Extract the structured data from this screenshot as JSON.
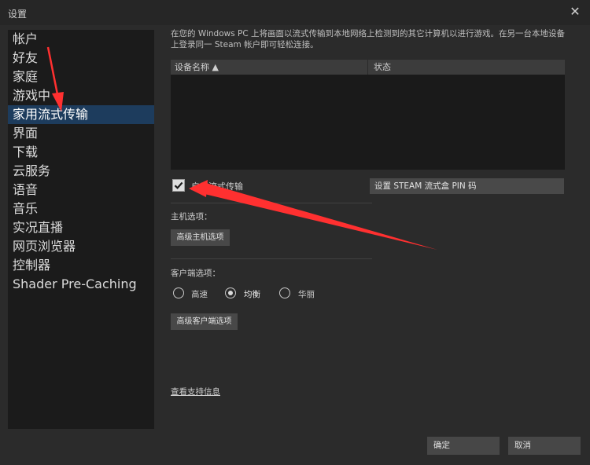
{
  "window": {
    "title": "设置",
    "close_glyph": "✕"
  },
  "sidebar": {
    "items": [
      {
        "label": "帐户"
      },
      {
        "label": "好友"
      },
      {
        "label": "家庭"
      },
      {
        "label": "游戏中"
      },
      {
        "label": "家用流式传输",
        "active": true
      },
      {
        "label": "界面"
      },
      {
        "label": "下载"
      },
      {
        "label": "云服务"
      },
      {
        "label": "语音"
      },
      {
        "label": "音乐"
      },
      {
        "label": "实况直播"
      },
      {
        "label": "网页浏览器"
      },
      {
        "label": "控制器"
      },
      {
        "label": "Shader Pre-Caching"
      }
    ]
  },
  "main": {
    "description": "在您的 Windows PC 上将画面以流式传输到本地网络上检测到的其它计算机以进行游戏。在另一台本地设备上登录同一 Steam 帐户即可轻松连接。",
    "table": {
      "col_device": "设备名称 ▲",
      "col_status": "状态"
    },
    "enable_streaming": {
      "label": "启用流式传输",
      "checked": true
    },
    "pin_button": "设置 STEAM 流式盒 PIN 码",
    "host_options": {
      "label": "主机选项：",
      "button": "高级主机选项"
    },
    "client_options": {
      "label": "客户端选项：",
      "radios": [
        {
          "label": "高速",
          "selected": false
        },
        {
          "label": "均衡",
          "selected": true
        },
        {
          "label": "华丽",
          "selected": false
        }
      ],
      "button": "高级客户端选项"
    },
    "support_link": "查看支持信息"
  },
  "footer": {
    "ok": "确定",
    "cancel": "取消"
  },
  "colors": {
    "annotation_arrow": "#ff3030",
    "active_item": "#1d3c5d"
  },
  "icons": [
    "close-icon",
    "check-icon",
    "radio-icon",
    "sort-ascending-icon"
  ]
}
